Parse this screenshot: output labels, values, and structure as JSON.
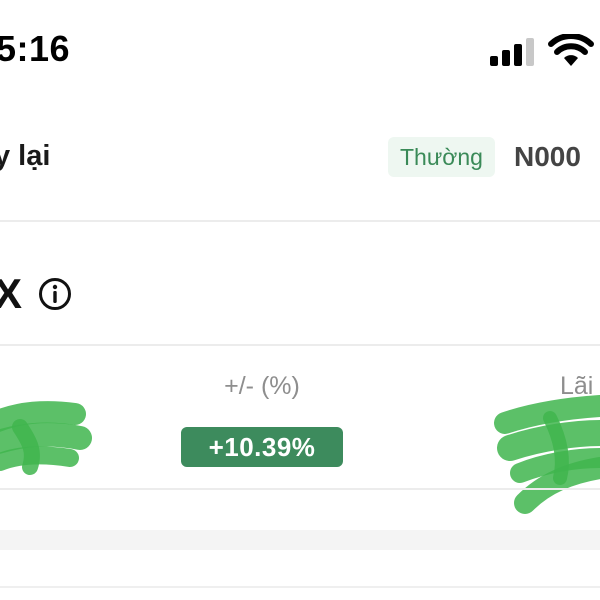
{
  "status_bar": {
    "time": "5:16",
    "icons": [
      "signal-icon",
      "wifi-icon"
    ]
  },
  "header": {
    "title": "y lại",
    "badge": "Thường",
    "account_code": "N000"
  },
  "symbol": {
    "text": "X",
    "icon": "info-icon"
  },
  "stats": {
    "change_label": "+/- (%)",
    "change_value": "+10.39%",
    "profit_label": "Lãi"
  },
  "colors": {
    "badge_bg": "#eef7f1",
    "badge_text": "#3a8a58",
    "positive": "#3d8b5d",
    "scribble": "#3fb54e"
  }
}
